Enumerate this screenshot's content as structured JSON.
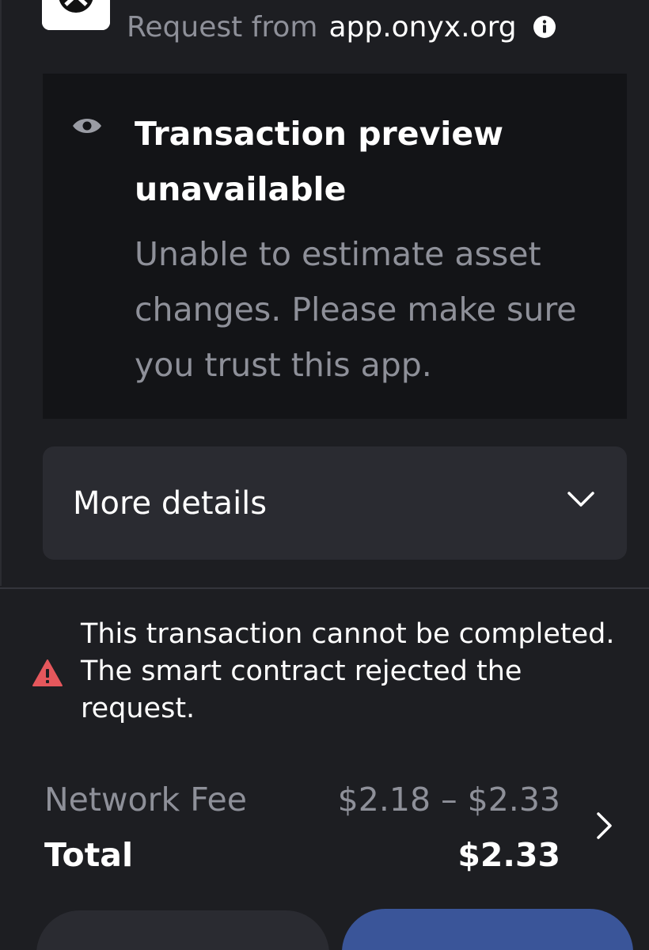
{
  "header": {
    "app_logo_icon": "onyx-logo-icon",
    "request_prefix": "Request from",
    "request_host": "app.onyx.org",
    "info_icon": "info-icon"
  },
  "preview": {
    "icon": "eye-icon",
    "title": "Transaction preview unavailable",
    "description": "Unable to estimate asset changes. Please make sure you trust this app."
  },
  "details": {
    "label": "More details",
    "icon": "chevron-down-icon"
  },
  "warning": {
    "icon": "warning-triangle-icon",
    "line1": "This transaction cannot be completed.",
    "line2": "The smart contract rejected the",
    "line3": "request.",
    "color": "#e5575c"
  },
  "fees": {
    "network_fee_label": "Network Fee",
    "network_fee_value": "$2.18 – $2.33",
    "total_label": "Total",
    "total_value": "$2.33",
    "icon": "chevron-right-icon"
  },
  "colors": {
    "background": "#1d1e22",
    "card": "#131417",
    "row": "#2a2b31",
    "muted_text": "#8e9099",
    "accent": "#3a5599"
  }
}
